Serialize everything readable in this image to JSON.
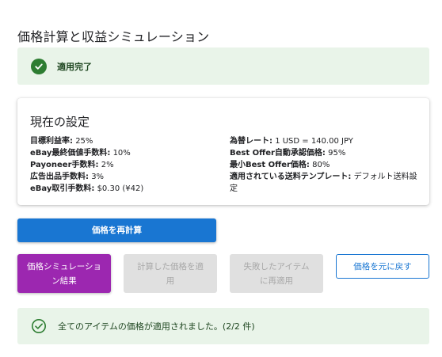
{
  "page_title": "価格計算と収益シミュレーション",
  "top_banner": {
    "icon": "check-circle-icon",
    "text": "適用完了"
  },
  "settings": {
    "title": "現在の設定",
    "left": [
      {
        "key": "目標利益率:",
        "value": "25%"
      },
      {
        "key": "eBay最終価値手数料:",
        "value": "10%"
      },
      {
        "key": "Payoneer手数料:",
        "value": "2%"
      },
      {
        "key": "広告出品手数料:",
        "value": "3%"
      },
      {
        "key": "eBay取引手数料:",
        "value": "$0.30 (¥42)"
      }
    ],
    "right": [
      {
        "key": "為替レート:",
        "value": "1 USD = 140.00 JPY"
      },
      {
        "key": "Best Offer自動承認価格:",
        "value": "95%"
      },
      {
        "key": "最小Best Offer価格:",
        "value": "80%"
      },
      {
        "key": "適用されている送料テンプレート:",
        "value": "デフォルト送料設定"
      }
    ]
  },
  "buttons": {
    "recalc": "価格を再計算",
    "simulation": "価格シミュレーション結果",
    "apply": "計算した価格を適用",
    "reapply": "失敗したアイテムに再適用",
    "revert": "価格を元に戻す"
  },
  "bottom_banner": {
    "icon": "check-circle-outline-icon",
    "text": "全てのアイテムの価格が適用されました。(2/2 件)"
  },
  "colors": {
    "success_bg": "#e9f4e9",
    "success_icon": "#2e7d32",
    "primary": "#1976d2",
    "secondary": "#9c27b0",
    "disabled_bg": "#e0e0e0"
  }
}
